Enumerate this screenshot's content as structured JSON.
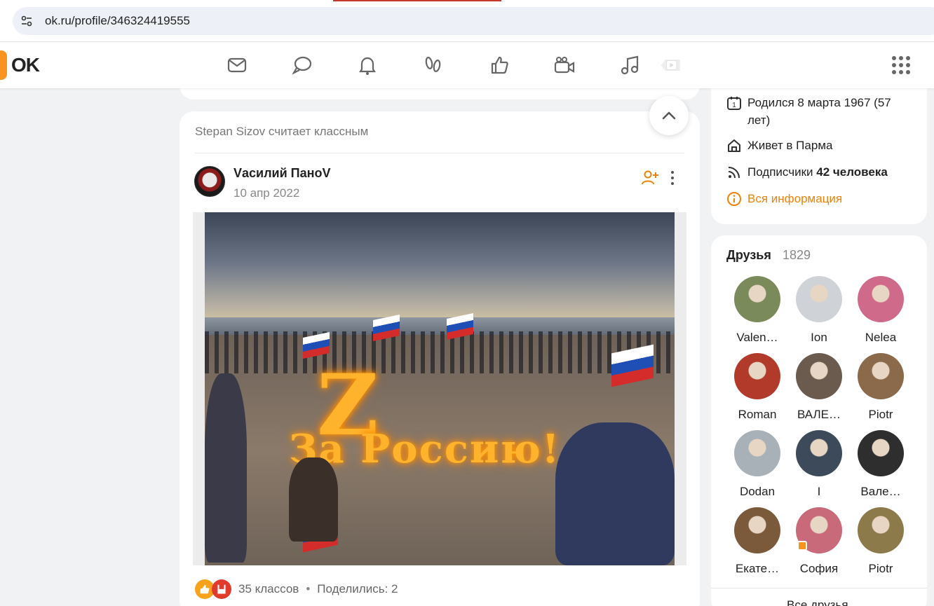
{
  "browser": {
    "url": "ok.ru/profile/346324419555",
    "site_info_icon": "tune-icon"
  },
  "header": {
    "logo": "OK",
    "nav_icons": [
      "mail-icon",
      "chat-icon",
      "bell-icon",
      "guests-icon",
      "like-icon",
      "video-camera-icon",
      "music-icon",
      "video-play-icon"
    ],
    "apps_icon": "apps-grid-icon"
  },
  "feed": {
    "liked_by": "Stepan Sizov считает классным",
    "post": {
      "author": "Vасилий ПаноV",
      "date": "10 апр 2022",
      "image_caption_z": "Z",
      "image_caption_text": "За Россию!",
      "classes": "35 классов",
      "separator": "•",
      "shared": "Поделились: 2"
    }
  },
  "profile_info": {
    "birthday": "Родился 8 марта 1967 (57 лет)",
    "lives_in": "Живет в Парма",
    "subscribers_label": "Подписчики",
    "subscribers_value": "42 человека",
    "all_info_link": "Вся информация"
  },
  "friends": {
    "title": "Друзья",
    "count": "1829",
    "list": [
      {
        "name": "Valen…",
        "color": "#7a8a5a"
      },
      {
        "name": "Ion",
        "color": "#cfd3d8"
      },
      {
        "name": "Nelea",
        "color": "#d06a8a"
      },
      {
        "name": "Roman",
        "color": "#b23a2a"
      },
      {
        "name": "ВАЛЕ…",
        "color": "#6b5a4e"
      },
      {
        "name": "Piotr",
        "color": "#8a6a4a"
      },
      {
        "name": "Dodan",
        "color": "#a8b0b8"
      },
      {
        "name": "I",
        "color": "#3c4a5a"
      },
      {
        "name": "Вале…",
        "color": "#2e2e2e"
      },
      {
        "name": "Екате…",
        "color": "#7a5a3a"
      },
      {
        "name": "София",
        "color": "#c86a7a"
      },
      {
        "name": "Piotr",
        "color": "#8c7a4a"
      }
    ],
    "all_friends": "Все друзья"
  }
}
